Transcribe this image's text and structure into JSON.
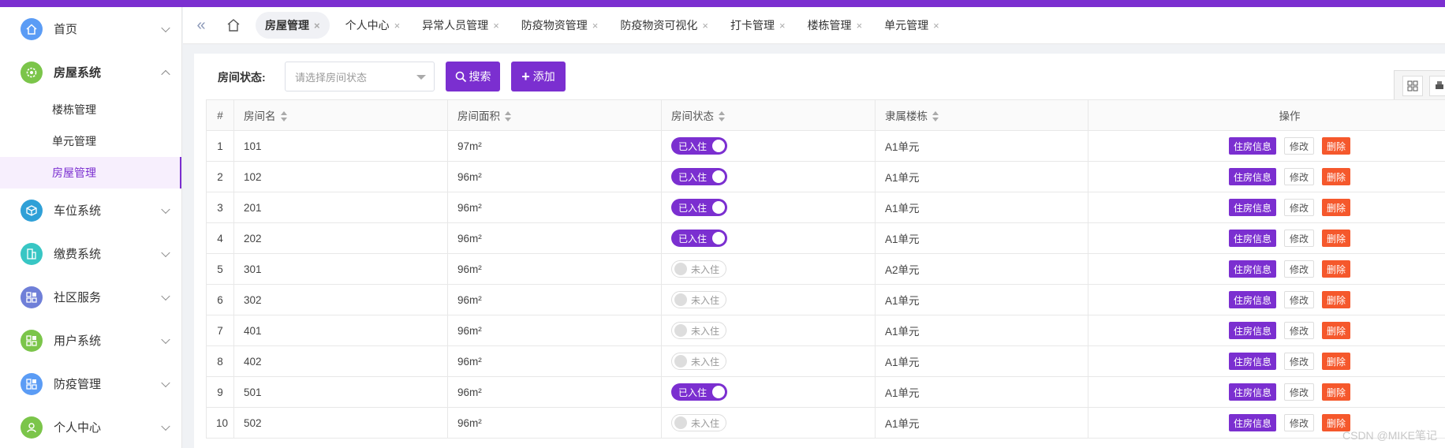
{
  "sidebar": {
    "items": [
      {
        "label": "首页",
        "color": "#5b9cf5",
        "icon": "home-icon",
        "open": false
      },
      {
        "label": "房屋系统",
        "color": "#7bc54a",
        "icon": "gear-icon",
        "open": true,
        "children": [
          {
            "label": "楼栋管理",
            "active": false
          },
          {
            "label": "单元管理",
            "active": false
          },
          {
            "label": "房屋管理",
            "active": true
          }
        ]
      },
      {
        "label": "车位系统",
        "color": "#2fa0d7",
        "icon": "cube-icon",
        "open": false
      },
      {
        "label": "缴费系统",
        "color": "#38c6c4",
        "icon": "building-icon",
        "open": false
      },
      {
        "label": "社区服务",
        "color": "#6f7fd8",
        "icon": "grid-icon",
        "open": false
      },
      {
        "label": "用户系统",
        "color": "#7bc54a",
        "icon": "grid-icon",
        "open": false
      },
      {
        "label": "防疫管理",
        "color": "#5b9cf5",
        "icon": "grid-icon",
        "open": false
      },
      {
        "label": "个人中心",
        "color": "#7bc54a",
        "icon": "user-icon",
        "open": false
      }
    ]
  },
  "tabs": [
    {
      "label": "房屋管理",
      "active": true
    },
    {
      "label": "个人中心",
      "active": false
    },
    {
      "label": "异常人员管理",
      "active": false
    },
    {
      "label": "防疫物资管理",
      "active": false
    },
    {
      "label": "防疫物资可视化",
      "active": false
    },
    {
      "label": "打卡管理",
      "active": false
    },
    {
      "label": "楼栋管理",
      "active": false
    },
    {
      "label": "单元管理",
      "active": false
    }
  ],
  "search": {
    "label": "房间状态:",
    "placeholder": "请选择房间状态",
    "search_btn": "搜索",
    "add_btn": "添加"
  },
  "table": {
    "headers": [
      "#",
      "房间名",
      "房间面积",
      "房间状态",
      "隶属楼栋",
      "操作"
    ],
    "actions": {
      "info": "住房信息",
      "edit": "修改",
      "delete": "删除"
    },
    "status_on": "已入住",
    "status_off": "未入住",
    "rows": [
      {
        "no": "1",
        "name": "101",
        "area": "97m²",
        "occupied": true,
        "building": "A1单元"
      },
      {
        "no": "2",
        "name": "102",
        "area": "96m²",
        "occupied": true,
        "building": "A1单元"
      },
      {
        "no": "3",
        "name": "201",
        "area": "96m²",
        "occupied": true,
        "building": "A1单元"
      },
      {
        "no": "4",
        "name": "202",
        "area": "96m²",
        "occupied": true,
        "building": "A1单元"
      },
      {
        "no": "5",
        "name": "301",
        "area": "96m²",
        "occupied": false,
        "building": "A2单元"
      },
      {
        "no": "6",
        "name": "302",
        "area": "96m²",
        "occupied": false,
        "building": "A1单元"
      },
      {
        "no": "7",
        "name": "401",
        "area": "96m²",
        "occupied": false,
        "building": "A1单元"
      },
      {
        "no": "8",
        "name": "402",
        "area": "96m²",
        "occupied": false,
        "building": "A1单元"
      },
      {
        "no": "9",
        "name": "501",
        "area": "96m²",
        "occupied": true,
        "building": "A1单元"
      },
      {
        "no": "10",
        "name": "502",
        "area": "96m²",
        "occupied": false,
        "building": "A1单元"
      }
    ]
  },
  "watermark": "CSDN @MIKE笔记",
  "colors": {
    "accent": "#7b2fd0",
    "danger": "#f5582c"
  }
}
